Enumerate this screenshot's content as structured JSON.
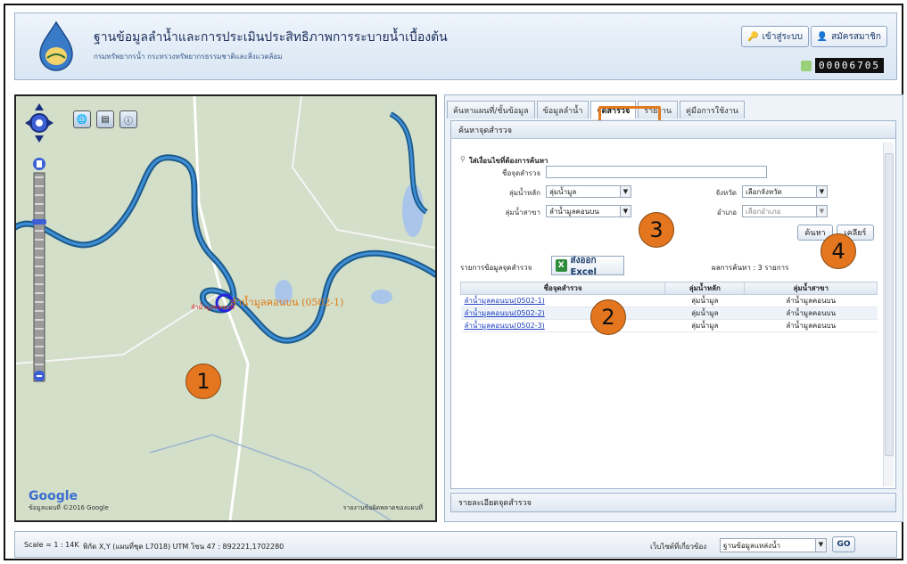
{
  "header": {
    "title": "ฐานข้อมูลลำน้ำและการประเมินประสิทธิภาพการระบายน้ำเบื้องต้น",
    "subtitle": "กรมทรัพยากรน้ำ กระทรวงทรัพยากรธรรมชาติและสิ่งแวดล้อม",
    "login_label": "เข้าสู่ระบบ",
    "register_label": "สมัครสมาชิก",
    "counter": "00006705"
  },
  "map": {
    "station_label": "ลำน้ำมูลคอนบน (0502-1)",
    "station_sub": "ลำน้ำมูลคอนบน",
    "badge1": "1",
    "credit": "ข้อมูลแผนที่ ©2016 Google",
    "terms": "รายงานข้อผิดพลาดของแผนที่"
  },
  "tabs": [
    {
      "label": "ค้นหาแผนที่/ชั้นข้อมูล"
    },
    {
      "label": "ข้อมูลลำน้ำ"
    },
    {
      "label": "จุดสำรวจ"
    },
    {
      "label": "รายงาน"
    },
    {
      "label": "คู่มือการใช้งาน"
    }
  ],
  "search": {
    "panel_title": "ค้นหาจุดสำรวจ",
    "section_label": "ใส่เงื่อนไขที่ต้องการค้นหา",
    "station_name_label": "ชื่อจุดสำรวจ",
    "station_name_value": "",
    "main_basin_label": "ลุ่มน้ำหลัก",
    "main_basin_value": "ลุ่มน้ำมูล",
    "sub_basin_label": "ลุ่มน้ำสาขา",
    "sub_basin_value": "ลำน้ำมูลคอนบน",
    "province_label": "จังหวัด",
    "province_value": "เลือกจังหวัด",
    "district_label": "อำเภอ",
    "district_value": "เลือกอำเภอ",
    "search_button": "ค้นหา",
    "clear_button": "เคลียร์"
  },
  "results": {
    "list_label": "รายการข้อมูลจุดสำรวจ",
    "export_label": "ส่งออก Excel",
    "count_text": "ผลการค้นหา : 3 รายการ",
    "columns": [
      "ชื่อจุดสำรวจ",
      "ลุ่มน้ำหลัก",
      "ลุ่มน้ำสาขา"
    ],
    "rows": [
      [
        "ลำน้ำมูลคอนบน(0502-1)",
        "ลุ่มน้ำมูล",
        "ลำน้ำมูลคอนบน"
      ],
      [
        "ลำน้ำมูลคอนบน(0502-2)",
        "ลุ่มน้ำมูล",
        "ลำน้ำมูลคอนบน"
      ],
      [
        "ลำน้ำมูลคอนบน(0502-3)",
        "ลุ่มน้ำมูล",
        "ลำน้ำมูลคอนบน"
      ]
    ]
  },
  "badges": {
    "b2": "2",
    "b3": "3",
    "b4": "4"
  },
  "detail_bar": "รายละเอียดจุดสำรวจ",
  "footer": {
    "scale": "Scale = 1 : 14K",
    "coords": "พิกัด X,Y (แผนที่ชุด L7018) UTM โซน 47 : 892221,1702280",
    "link_label": "เว็บไซต์ที่เกี่ยวข้อง",
    "link_select": "ฐานข้อมูลแหล่งน้ำ",
    "go_button": "GO"
  },
  "colors": {
    "accent_orange": "#e3761f",
    "river": "#1c5a8a",
    "link": "#1f3fbf"
  }
}
